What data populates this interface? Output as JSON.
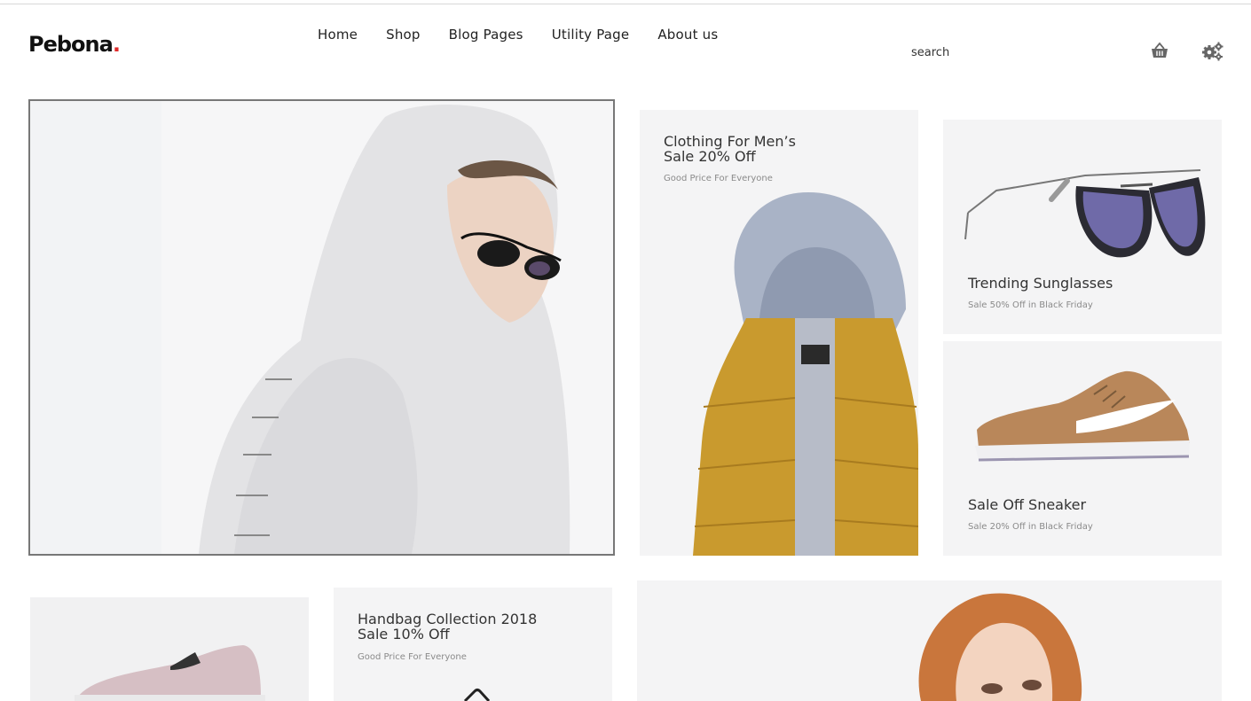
{
  "header": {
    "logo_text": "Pebona",
    "logo_dot": ".",
    "nav": [
      "Home",
      "Shop",
      "Blog Pages",
      "Utility Page",
      "About us"
    ],
    "search_placeholder": "search",
    "icons": [
      "basket-icon",
      "settings-gears-icon"
    ]
  },
  "banners": {
    "clothing": {
      "title_line1": "Clothing For Men’s",
      "title_line2": "Sale 20% Off",
      "subtitle": "Good Price For Everyone"
    },
    "sunglasses": {
      "title": "Trending Sunglasses",
      "subtitle": "Sale 50% Off in Black Friday"
    },
    "sneaker": {
      "title": "Sale Off Sneaker",
      "subtitle": "Sale 20% Off in Black Friday"
    },
    "handbag": {
      "title_line1": "Handbag Collection 2018",
      "title_line2": "Sale 10% Off",
      "subtitle": "Good Price For Everyone"
    }
  },
  "colors": {
    "accent": "#e02a2a",
    "card_bg": "#f4f4f5",
    "jacket": "#c99a2e",
    "sneaker": "#b9875a"
  }
}
